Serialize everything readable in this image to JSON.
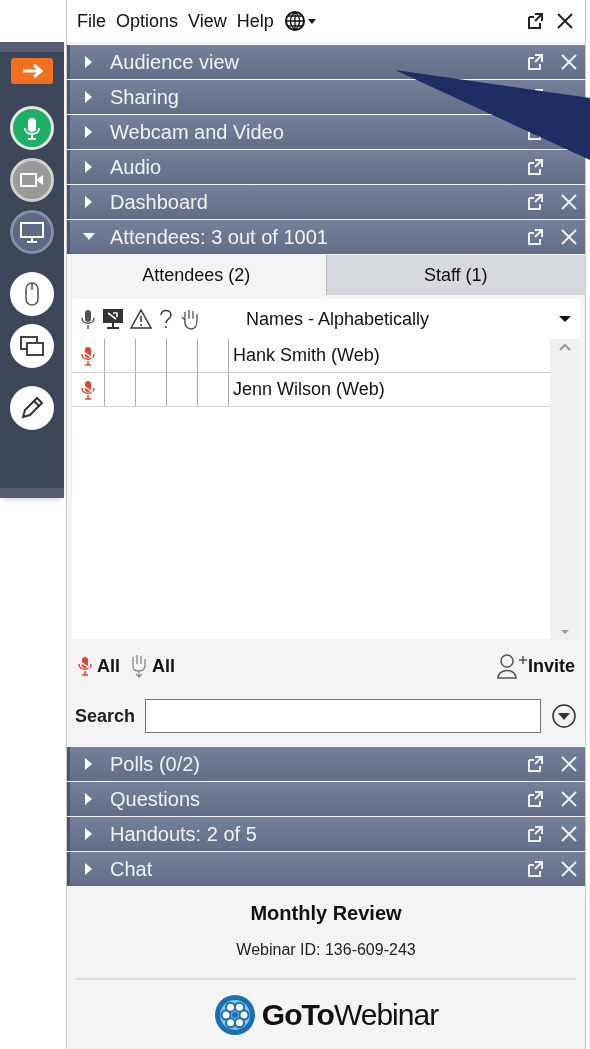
{
  "menu": [
    "File",
    "Options",
    "View",
    "Help"
  ],
  "toolbar": [
    {
      "kind": "arrow"
    },
    {
      "kind": "mic"
    },
    {
      "kind": "webcam"
    },
    {
      "kind": "screen"
    },
    {
      "kind": "mouse"
    },
    {
      "kind": "screens"
    },
    {
      "kind": "pen"
    }
  ],
  "sections_top": [
    {
      "title": "Audience view",
      "expanded": false,
      "popout": true,
      "close": true
    },
    {
      "title": "Sharing",
      "expanded": false,
      "popout": true,
      "close": false
    },
    {
      "title": "Webcam and Video",
      "expanded": false,
      "popout": true,
      "close": false
    },
    {
      "title": "Audio",
      "expanded": false,
      "popout": true,
      "close": false
    },
    {
      "title": "Dashboard",
      "expanded": false,
      "popout": true,
      "close": true
    },
    {
      "title": "Attendees:  3 out of 1001",
      "expanded": true,
      "popout": true,
      "close": true
    }
  ],
  "tabs": [
    {
      "label": "Attendees (2)",
      "selected": true
    },
    {
      "label": "Staff (1)",
      "selected": false
    }
  ],
  "sort": "Names - Alphabetically",
  "rows": [
    {
      "name": "Hank Smith (Web)",
      "muted": true
    },
    {
      "name": "Jenn Wilson (Web)",
      "muted": true
    }
  ],
  "actions": [
    {
      "kind": "mute",
      "label": "All"
    },
    {
      "kind": "hand",
      "label": "All"
    }
  ],
  "invite": "Invite",
  "search": {
    "label": "Search"
  },
  "sections_bottom": [
    {
      "title": "Polls (0/2)",
      "expanded": false,
      "popout": true,
      "close": true
    },
    {
      "title": "Questions",
      "expanded": false,
      "popout": true,
      "close": true
    },
    {
      "title": "Handouts: 2 of 5",
      "expanded": false,
      "popout": true,
      "close": true
    },
    {
      "title": "Chat",
      "expanded": false,
      "popout": true,
      "close": true
    }
  ],
  "footer": {
    "title": "Monthly Review",
    "webinar_id": "Webinar ID: 136-609-243",
    "logo_bold": "GoTo",
    "logo_light": "Webinar"
  }
}
